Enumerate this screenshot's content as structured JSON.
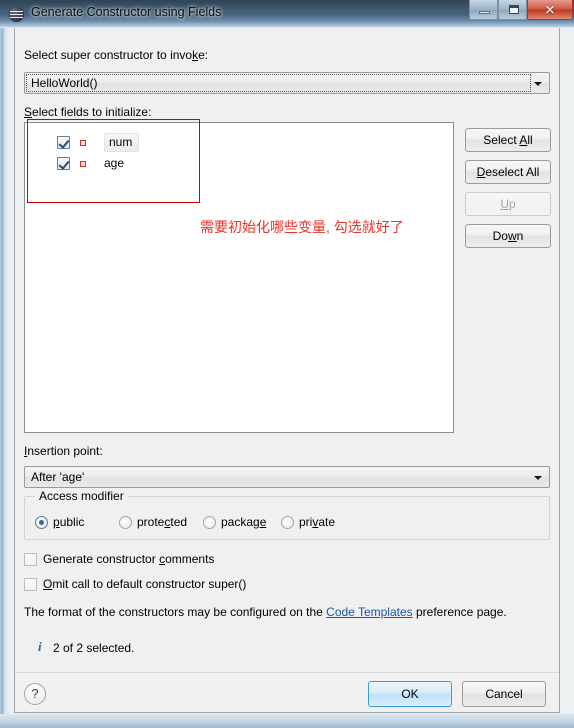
{
  "window": {
    "title": "Generate Constructor using Fields",
    "icon": "eclipse-icon",
    "controls": {
      "minimize": "minimize-icon",
      "maximize": "maximize-icon",
      "close": "✕"
    }
  },
  "super_constructor": {
    "label": "Select super constructor to invoke:",
    "label_mnemonic": "k",
    "value": "HelloWorld()"
  },
  "fields_section": {
    "label": "Select fields to initialize:",
    "label_mnemonic": "S",
    "items": [
      {
        "name": "num",
        "checked": true,
        "selected": true,
        "icon": "private-field-icon"
      },
      {
        "name": "age",
        "checked": true,
        "selected": false,
        "icon": "private-field-icon"
      }
    ],
    "buttons": [
      {
        "label": "Select All",
        "mnemonic": "A",
        "enabled": true
      },
      {
        "label": "Deselect All",
        "mnemonic": "D",
        "enabled": true
      },
      {
        "label": "Up",
        "mnemonic": "U",
        "enabled": false
      },
      {
        "label": "Down",
        "mnemonic": "w",
        "enabled": true
      }
    ]
  },
  "insertion_point": {
    "label": "Insertion point:",
    "label_mnemonic": "I",
    "value": "After 'age'"
  },
  "access_modifier": {
    "title": "Access modifier",
    "options": [
      {
        "label": "public",
        "mnemonic": "p",
        "selected": true
      },
      {
        "label": "protected",
        "mnemonic": "c",
        "selected": false
      },
      {
        "label": "package",
        "mnemonic": "e",
        "selected": false
      },
      {
        "label": "private",
        "mnemonic": "v",
        "selected": false
      }
    ]
  },
  "options": [
    {
      "label": "Generate constructor comments",
      "mnemonic": "c",
      "checked": false
    },
    {
      "label": "Omit call to default constructor super()",
      "mnemonic": "O",
      "checked": false
    }
  ],
  "hint": {
    "prefix": "The format of the constructors may be configured on the ",
    "link": "Code Templates",
    "suffix": " preference page."
  },
  "status": {
    "icon": "info-icon",
    "text": "2 of 2 selected."
  },
  "footer": {
    "help": "?",
    "ok": "OK",
    "cancel": "Cancel"
  },
  "annotations": {
    "note": "需要初始化哪些变量, 勾选就好了",
    "color": "#e8322a"
  }
}
